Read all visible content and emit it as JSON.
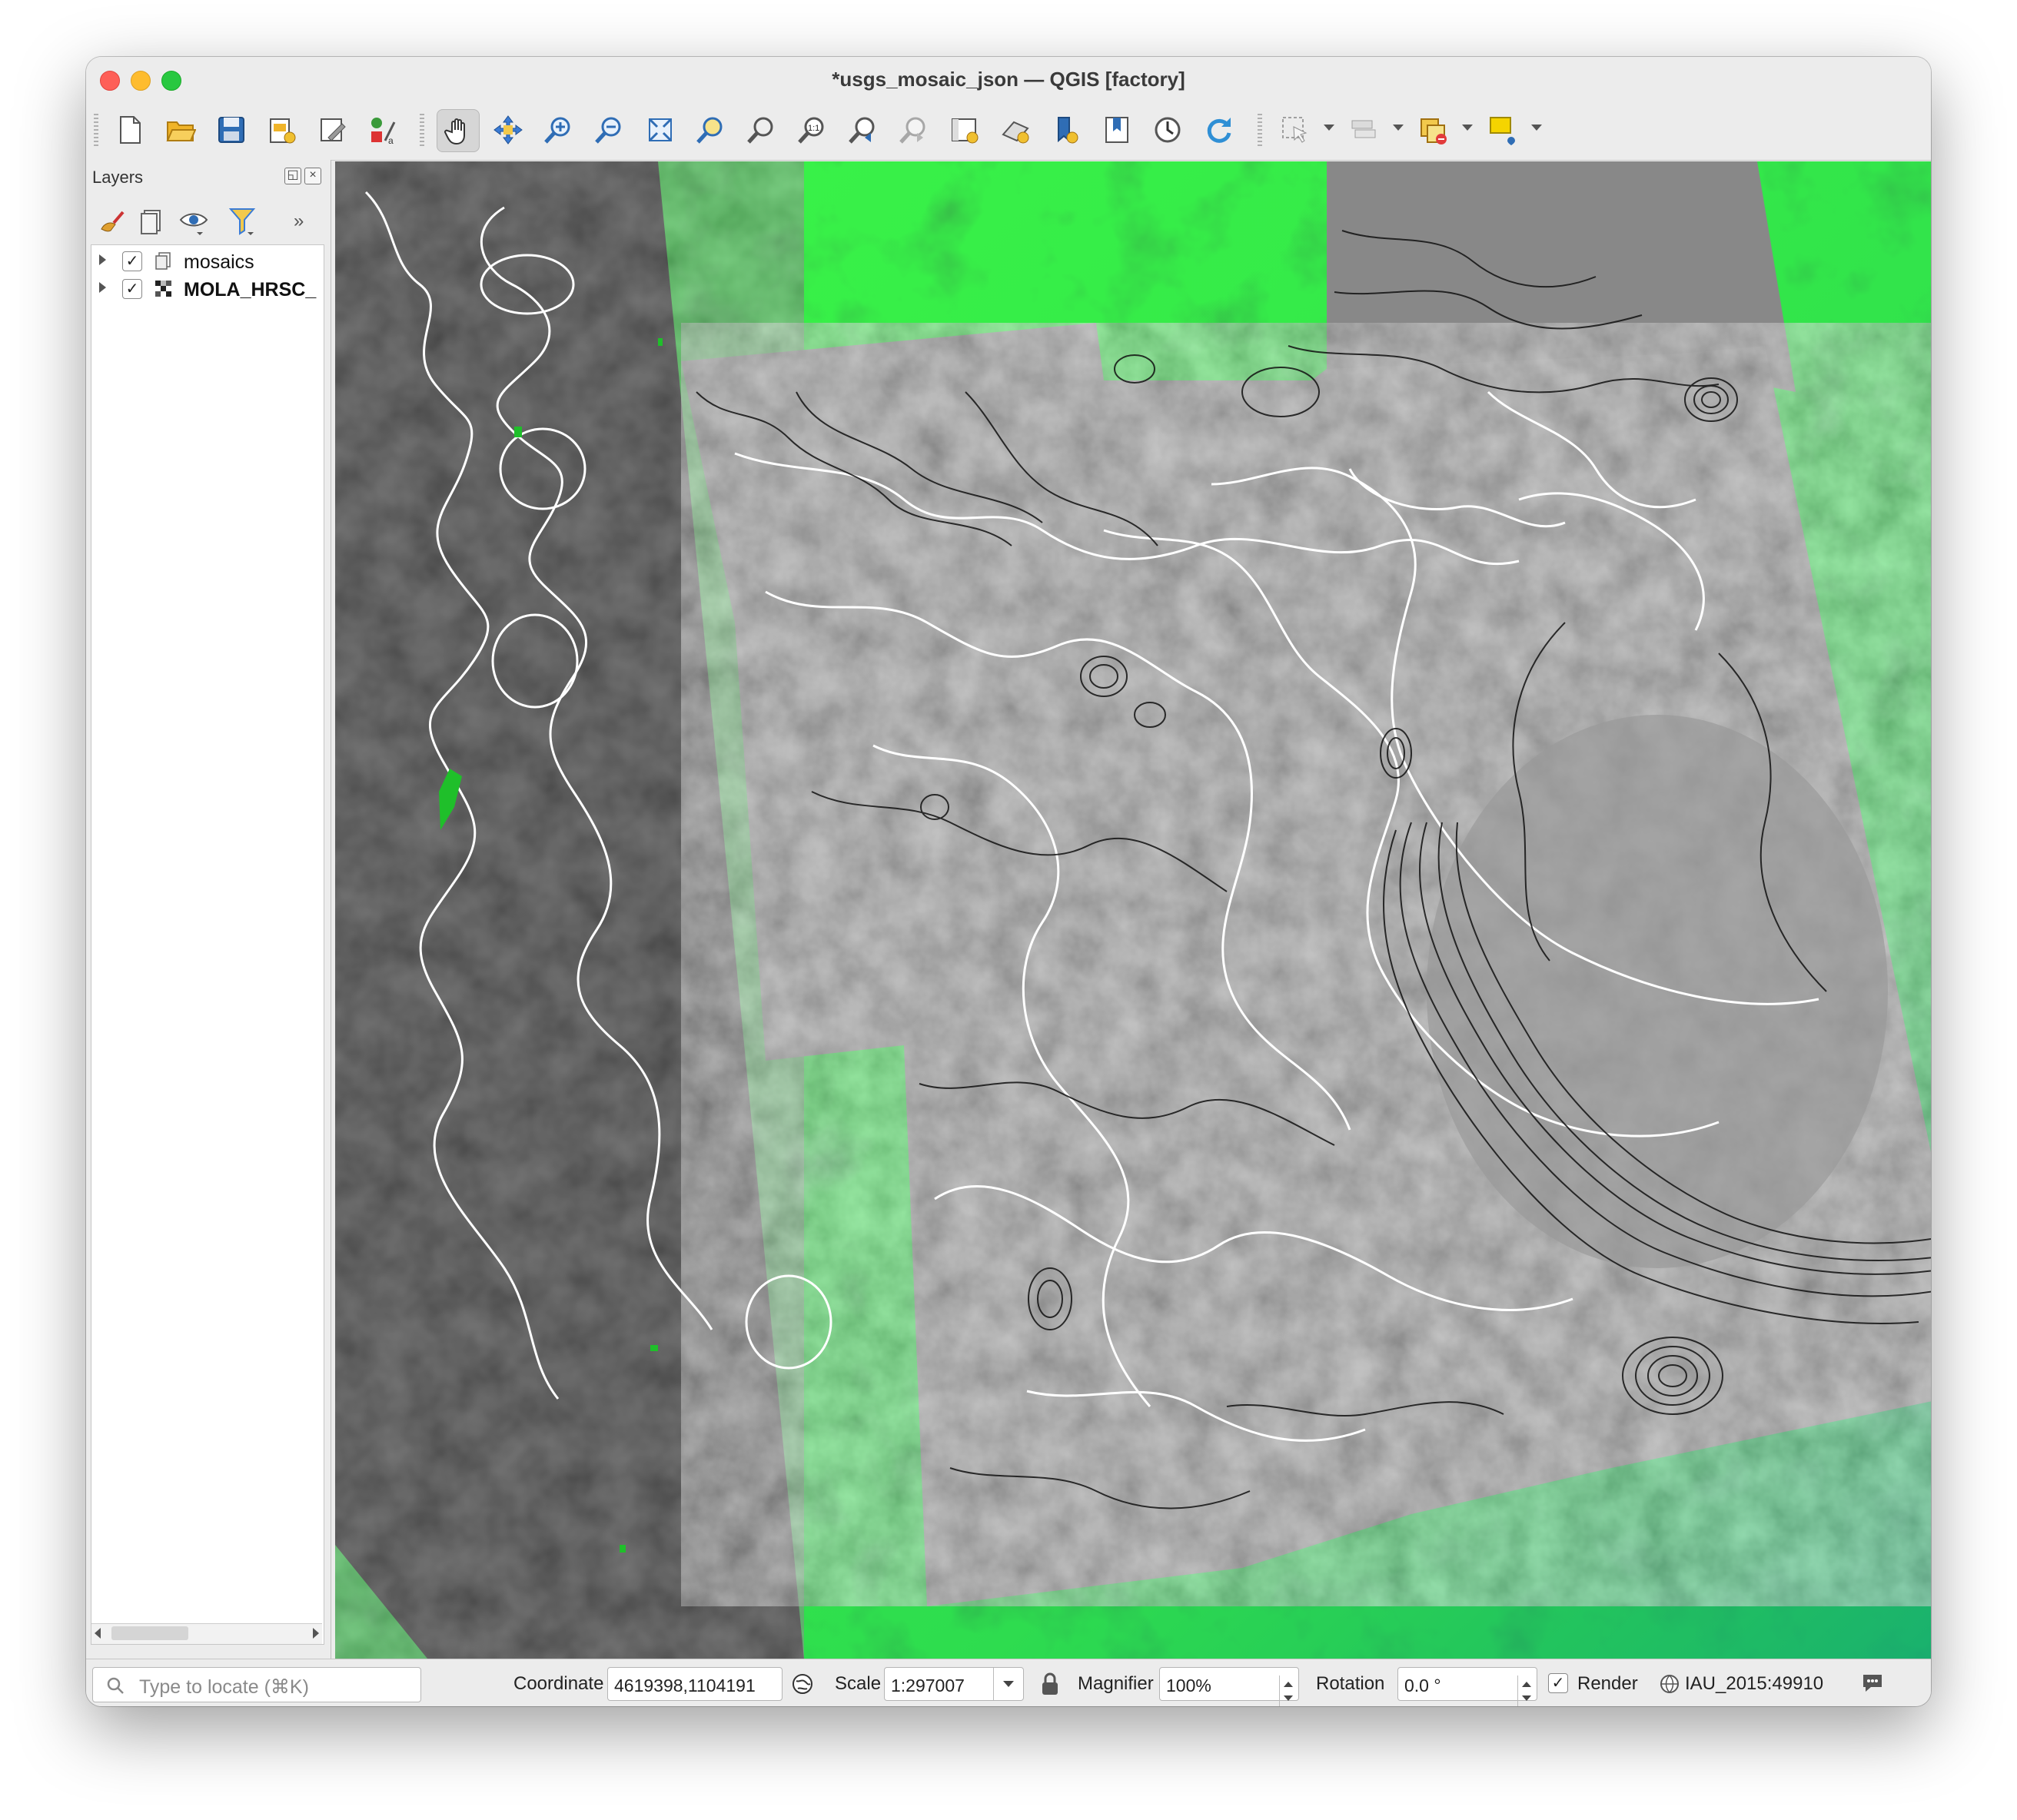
{
  "window": {
    "title": "*usgs_mosaic_json — QGIS [factory]"
  },
  "toolbar": {
    "icons": [
      "new-project-icon",
      "open-project-icon",
      "save-project-icon",
      "new-print-layout-icon",
      "layout-manager-icon",
      "style-manager-icon",
      "pan-map-icon",
      "pan-to-selection-icon",
      "zoom-in-icon",
      "zoom-out-icon",
      "zoom-full-icon",
      "zoom-to-selection-icon",
      "zoom-to-layer-icon",
      "zoom-native-resolution-icon",
      "zoom-last-icon",
      "zoom-next-icon",
      "new-map-view-icon",
      "new-3d-map-view-icon",
      "new-bookmark-icon",
      "show-bookmarks-icon",
      "temporal-controller-icon",
      "refresh-icon",
      "select-features-icon",
      "deselect-icon",
      "identify-icon",
      "annotation-icon"
    ],
    "native_zoom_text": "1:1"
  },
  "layers_panel": {
    "title": "Layers",
    "layers": [
      {
        "name": "mosaics",
        "checked": true,
        "icon": "group-icon",
        "bold": false
      },
      {
        "name": "MOLA_HRSC_",
        "checked": true,
        "icon": "raster-layer-icon",
        "bold": true
      }
    ]
  },
  "statusbar": {
    "locator_placeholder": "Type to locate (⌘K)",
    "coordinate_label": "Coordinate",
    "coordinate_value": "4619398,1104191",
    "scale_label": "Scale",
    "scale_value": "1:297007",
    "magnifier_label": "Magnifier",
    "magnifier_value": "100%",
    "rotation_label": "Rotation",
    "rotation_value": "0.0 °",
    "render_label": "Render",
    "render_checked": true,
    "crs": "IAU_2015:49910"
  },
  "colors": {
    "green_base": "#1fbf2a",
    "dem_teal": "#1aa07a",
    "mosaic_gray": "#8c8c8c",
    "contour_white": "#ffffff",
    "contour_black": "#111111"
  }
}
